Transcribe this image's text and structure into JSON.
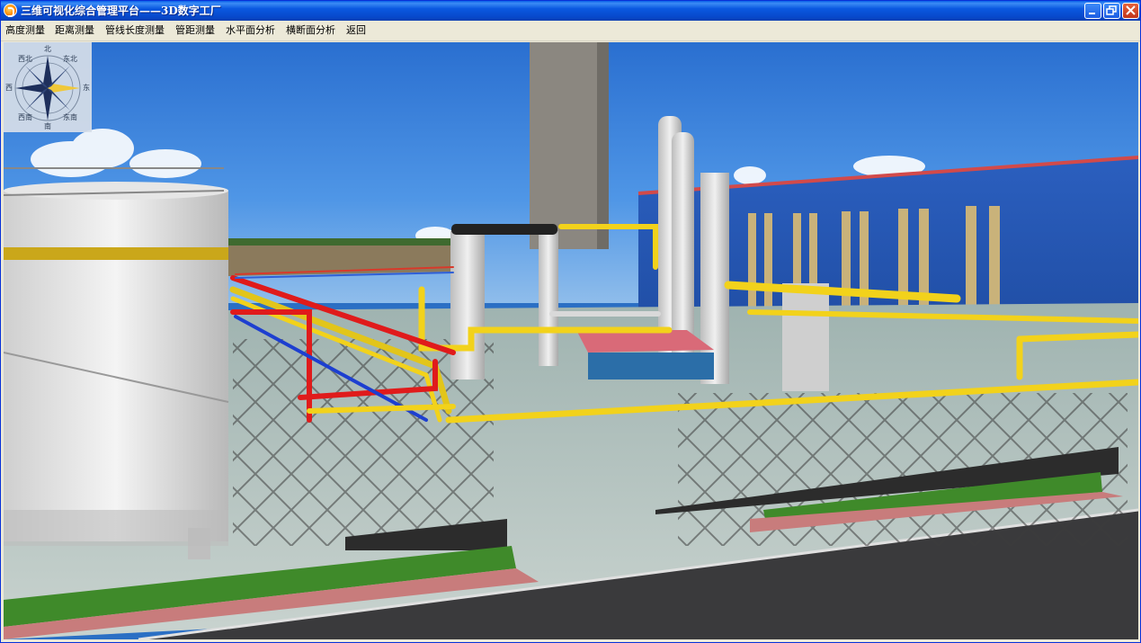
{
  "window": {
    "title": "三维可视化综合管理平台——3D数字工厂",
    "controls": [
      "minimize",
      "maximize",
      "close"
    ]
  },
  "menu": {
    "items": [
      {
        "label": "高度测量"
      },
      {
        "label": "距离测量"
      },
      {
        "label": "管线长度测量"
      },
      {
        "label": "管距测量"
      },
      {
        "label": "水平面分析"
      },
      {
        "label": "横断面分析"
      },
      {
        "label": "返回"
      }
    ]
  },
  "compass": {
    "north": "北",
    "south": "南",
    "east": "东",
    "west": "西",
    "northeast": "东北",
    "northwest": "西北",
    "southeast": "东南",
    "southwest": "西南"
  },
  "scene": {
    "icon": "factory-3d-scene",
    "colors": {
      "sky": "#2f7fd8",
      "building": "#1f4fa8",
      "pipe_yellow": "#f2d21b",
      "pipe_red": "#e01b1b",
      "pipe_blue": "#1d3fd0",
      "road": "#3b3b3d",
      "grass": "#3f8a2a"
    }
  }
}
